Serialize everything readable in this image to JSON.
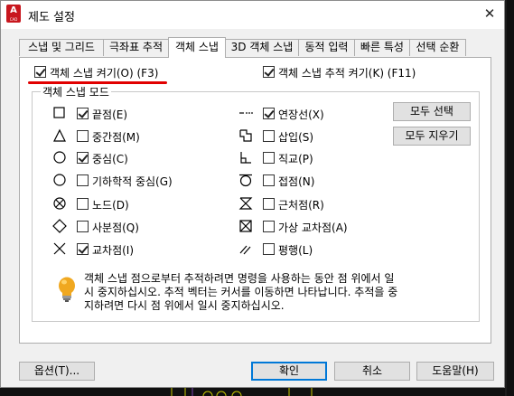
{
  "window": {
    "title": "제도 설정",
    "app_icon_letter": "A",
    "app_icon_sub": "CAD"
  },
  "tabs": [
    {
      "label": "스냅 및 그리드"
    },
    {
      "label": "극좌표 추적"
    },
    {
      "label": "객체 스냅"
    },
    {
      "label": "3D 객체 스냅"
    },
    {
      "label": "동적 입력"
    },
    {
      "label": "빠른 특성"
    },
    {
      "label": "선택 순환"
    }
  ],
  "active_tab": "객체 스냅",
  "osnap_on": {
    "label": "객체 스냅 켜기(O) (F3)",
    "checked": true
  },
  "osnap_tracking": {
    "label": "객체 스냅 추적 켜기(K) (F11)",
    "checked": true
  },
  "group_title": "객체 스냅 모드",
  "modes_left": [
    {
      "label": "끝점(E)",
      "checked": true,
      "icon": "endpoint-square-icon"
    },
    {
      "label": "중간점(M)",
      "checked": false,
      "icon": "midpoint-triangle-icon"
    },
    {
      "label": "중심(C)",
      "checked": true,
      "icon": "center-circle-icon"
    },
    {
      "label": "기하학적 중심(G)",
      "checked": false,
      "icon": "geometric-center-icon"
    },
    {
      "label": "노드(D)",
      "checked": false,
      "icon": "node-icon"
    },
    {
      "label": "사분점(Q)",
      "checked": false,
      "icon": "quadrant-diamond-icon"
    },
    {
      "label": "교차점(I)",
      "checked": true,
      "icon": "intersection-x-icon"
    }
  ],
  "modes_right": [
    {
      "label": "연장선(X)",
      "checked": true,
      "icon": "extension-icon"
    },
    {
      "label": "삽입(S)",
      "checked": false,
      "icon": "insertion-icon"
    },
    {
      "label": "직교(P)",
      "checked": false,
      "icon": "perpendicular-icon"
    },
    {
      "label": "접점(N)",
      "checked": false,
      "icon": "tangent-icon"
    },
    {
      "label": "근처점(R)",
      "checked": false,
      "icon": "nearest-icon"
    },
    {
      "label": "가상 교차점(A)",
      "checked": false,
      "icon": "apparent-intersection-icon"
    },
    {
      "label": "평행(L)",
      "checked": false,
      "icon": "parallel-icon"
    }
  ],
  "buttons": {
    "select_all": "모두 선택",
    "clear_all": "모두 지우기"
  },
  "info_text": [
    "객체 스냅 점으로부터 추적하려면 명령을 사용하는 동안 점 위에서 일",
    "시 중지하십시오. 추적 벡터는 커서를 이동하면 나타납니다. 추적을 중",
    "지하려면 다시 점 위에서 일시 중지하십시오."
  ],
  "footer": {
    "options": "옵션(T)...",
    "ok": "확인",
    "cancel": "취소",
    "help": "도움말(H)"
  },
  "colors": {
    "accent_blue": "#0078d7",
    "highlight_red": "#e10000",
    "app_red": "#c8171e",
    "bulb_yellow": "#f0a820"
  }
}
